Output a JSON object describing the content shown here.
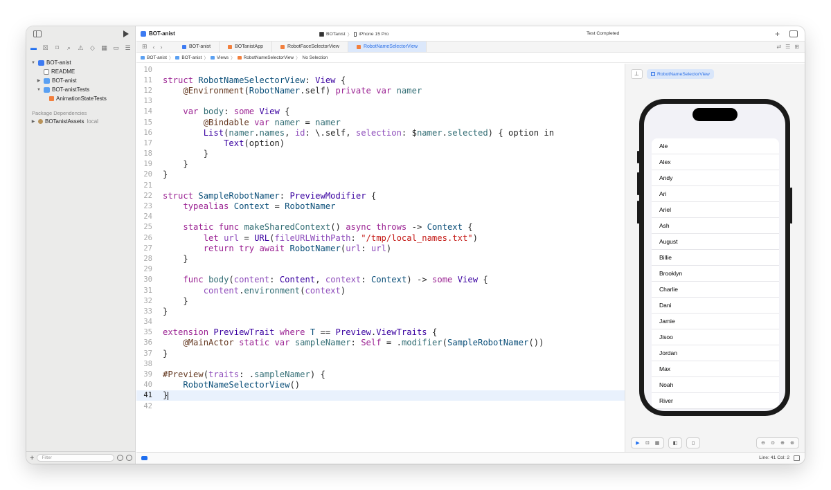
{
  "sidebar": {
    "tree": [
      {
        "label": "BOT-anist",
        "icon": "xcode-project-icon",
        "disclosure": "open",
        "indent": 0
      },
      {
        "label": "README",
        "icon": "document-icon",
        "disclosure": "",
        "indent": 1
      },
      {
        "label": "BOT-anist",
        "icon": "folder-icon",
        "disclosure": "closed",
        "indent": 1
      },
      {
        "label": "BOT-anistTests",
        "icon": "folder-icon",
        "disclosure": "open",
        "indent": 1
      },
      {
        "label": "AnimationStateTests",
        "icon": "swift-file-icon",
        "disclosure": "",
        "indent": 2
      }
    ],
    "package_header": "Package Dependencies",
    "package": {
      "label": "BOTanistAssets",
      "suffix": "local"
    },
    "filter_placeholder": "Filter"
  },
  "toolbar": {
    "project_title": "BOT-anist",
    "scheme": "BOTanist",
    "destination": "iPhone 15 Pro",
    "status": "Test Completed"
  },
  "tabs": [
    {
      "label": "BOT-anist",
      "icon": "blue"
    },
    {
      "label": "BOTanistApp",
      "icon": "orange"
    },
    {
      "label": "RobotFaceSelectorView",
      "icon": "orange"
    },
    {
      "label": "RobotNameSelectorView",
      "icon": "orange",
      "active": true
    }
  ],
  "jumpbar": [
    "BOT-anist",
    "BOT-anist",
    "Views",
    "RobotNameSelectorView",
    "No Selection"
  ],
  "editor": {
    "current_line": 41,
    "lines": [
      {
        "n": "10",
        "t": ""
      },
      {
        "n": "11",
        "t": "struct RobotNameSelectorView: View {"
      },
      {
        "n": "12",
        "t": "    @Environment(RobotNamer.self) private var namer"
      },
      {
        "n": "13",
        "t": ""
      },
      {
        "n": "14",
        "t": "    var body: some View {"
      },
      {
        "n": "15",
        "t": "        @Bindable var namer = namer"
      },
      {
        "n": "16",
        "t": "        List(namer.names, id: \\.self, selection: $namer.selected) { option in"
      },
      {
        "n": "17",
        "t": "            Text(option)"
      },
      {
        "n": "18",
        "t": "        }"
      },
      {
        "n": "19",
        "t": "    }"
      },
      {
        "n": "20",
        "t": "}"
      },
      {
        "n": "21",
        "t": ""
      },
      {
        "n": "22",
        "t": "struct SampleRobotNamer: PreviewModifier {"
      },
      {
        "n": "23",
        "t": "    typealias Context = RobotNamer"
      },
      {
        "n": "24",
        "t": ""
      },
      {
        "n": "25",
        "t": "    static func makeSharedContext() async throws -> Context {"
      },
      {
        "n": "26",
        "t": "        let url = URL(fileURLWithPath: \"/tmp/local_names.txt\")"
      },
      {
        "n": "27",
        "t": "        return try await RobotNamer(url: url)"
      },
      {
        "n": "28",
        "t": "    }"
      },
      {
        "n": "29",
        "t": ""
      },
      {
        "n": "30",
        "t": "    func body(content: Content, context: Context) -> some View {"
      },
      {
        "n": "31",
        "t": "        content.environment(context)"
      },
      {
        "n": "32",
        "t": "    }"
      },
      {
        "n": "33",
        "t": "}"
      },
      {
        "n": "34",
        "t": ""
      },
      {
        "n": "35",
        "t": "extension PreviewTrait where T == Preview.ViewTraits {"
      },
      {
        "n": "36",
        "t": "    @MainActor static var sampleNamer: Self = .modifier(SampleRobotNamer())"
      },
      {
        "n": "37",
        "t": "}"
      },
      {
        "n": "38",
        "t": ""
      },
      {
        "n": "39",
        "t": "#Preview(traits: .sampleNamer) {"
      },
      {
        "n": "40",
        "t": "    RobotNameSelectorView()"
      },
      {
        "n": "41",
        "t": "}"
      },
      {
        "n": "42",
        "t": ""
      }
    ]
  },
  "canvas": {
    "preview_label": "RobotNameSelectorView",
    "names": [
      "Ale",
      "Alex",
      "Andy",
      "Ari",
      "Ariel",
      "Ash",
      "August",
      "Billie",
      "Brooklyn",
      "Charlie",
      "Dani",
      "Jamie",
      "Jisoo",
      "Jordan",
      "Max",
      "Noah",
      "River"
    ]
  },
  "statusbar": {
    "position": "Line: 41  Col: 2"
  },
  "colors": {
    "accent": "#1e6ef0",
    "keyword": "#9b2393",
    "string": "#c41a16",
    "type": "#3900a0"
  }
}
